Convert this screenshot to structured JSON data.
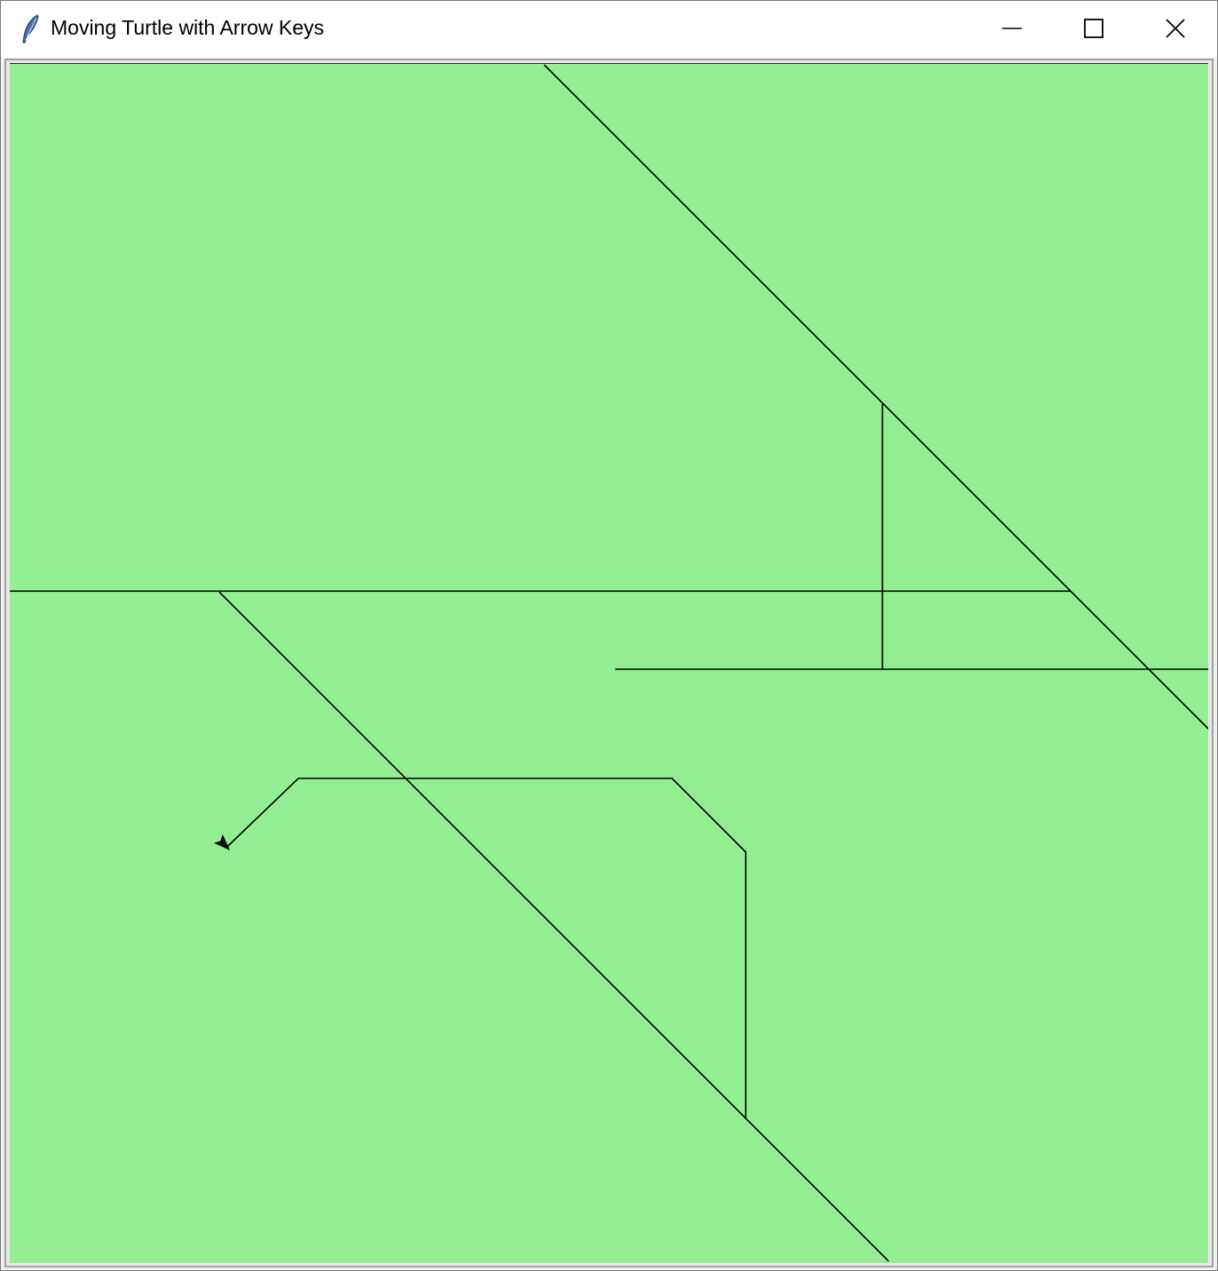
{
  "window": {
    "title": "Moving Turtle with Arrow Keys",
    "app_icon": "tk-feather-icon",
    "controls": {
      "minimize": "minimize-icon",
      "maximize": "maximize-icon",
      "close": "close-icon"
    }
  },
  "canvas": {
    "background_color": "#93ee93",
    "pen_color": "#000000",
    "turtle_icon": "turtle-arrow-icon",
    "turtle_heading": "southwest"
  }
}
